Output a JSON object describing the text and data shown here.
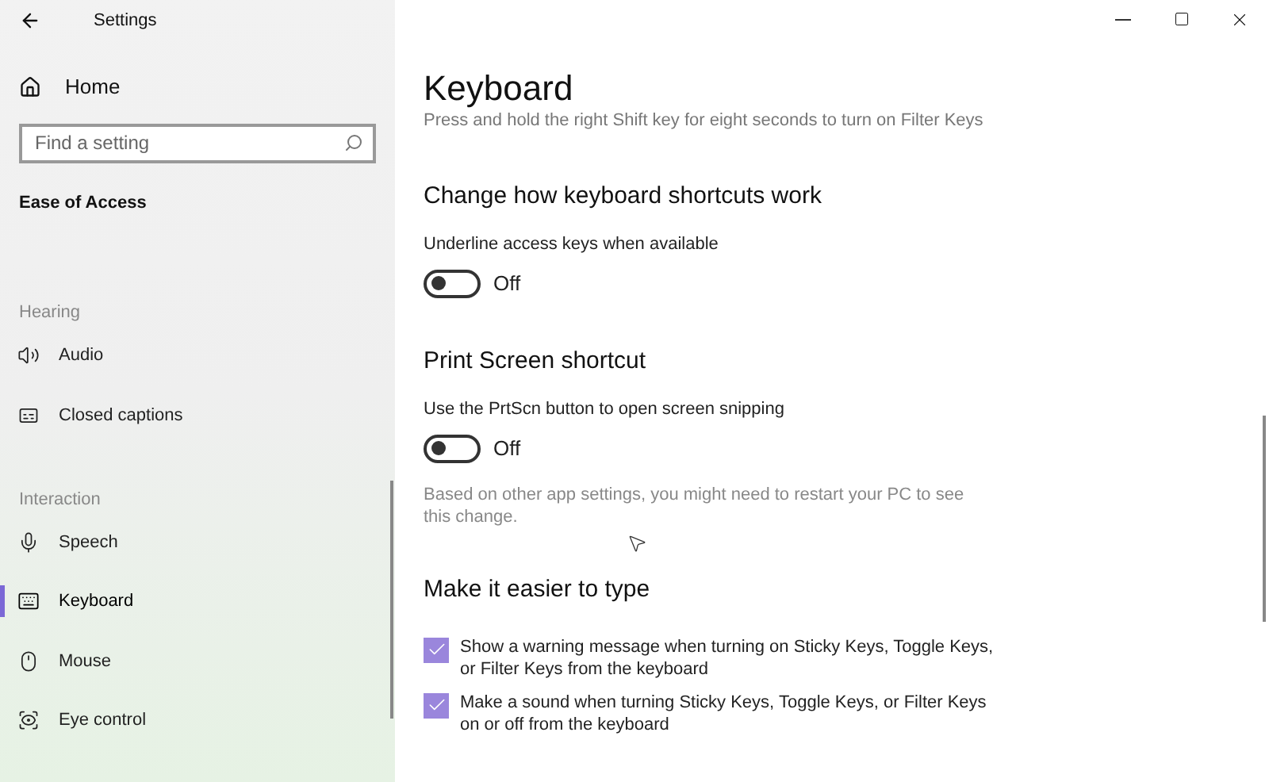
{
  "window": {
    "title": "Settings"
  },
  "sidebar": {
    "home": "Home",
    "search": {
      "placeholder": "Find a setting"
    },
    "category": "Ease of Access",
    "groups": [
      {
        "heading": "Hearing",
        "items": [
          {
            "kind": "audio",
            "label": "Audio",
            "selected": false
          },
          {
            "kind": "captions",
            "label": "Closed captions",
            "selected": false
          }
        ]
      },
      {
        "heading": "Interaction",
        "items": [
          {
            "kind": "speech",
            "label": "Speech",
            "selected": false
          },
          {
            "kind": "keyboard",
            "label": "Keyboard",
            "selected": true
          },
          {
            "kind": "mouse",
            "label": "Mouse",
            "selected": false
          },
          {
            "kind": "eye",
            "label": "Eye control",
            "selected": false
          }
        ]
      }
    ]
  },
  "page": {
    "title": "Keyboard",
    "intro": "Press and hold the right Shift key for eight seconds to turn on Filter Keys",
    "sections": [
      {
        "heading": "Change how keyboard shortcuts work",
        "items": [
          {
            "kind": "toggle",
            "label": "Underline access keys when available",
            "on": false,
            "state": "Off"
          }
        ]
      },
      {
        "heading": "Print Screen shortcut",
        "items": [
          {
            "kind": "toggle",
            "label": "Use the PrtScn button to open screen snipping",
            "on": false,
            "state": "Off"
          },
          {
            "kind": "note",
            "text": "Based on other app settings, you might need to restart your PC to see this change."
          }
        ]
      },
      {
        "heading": "Make it easier to type",
        "items": [
          {
            "kind": "checkbox",
            "label": "Show a warning message when turning on Sticky Keys, Toggle Keys, or Filter Keys from the keyboard",
            "checked": true
          },
          {
            "kind": "checkbox",
            "label": "Make a sound when turning Sticky Keys, Toggle Keys, or Filter Keys on or off from the keyboard",
            "checked": true
          }
        ]
      }
    ]
  }
}
